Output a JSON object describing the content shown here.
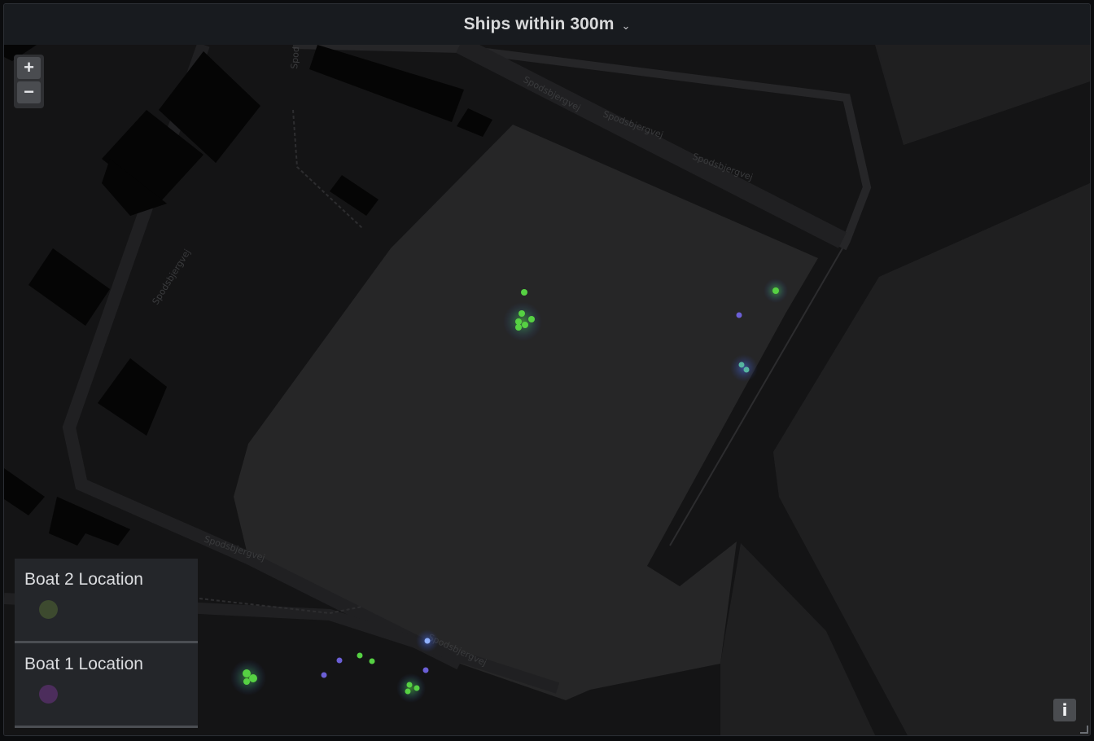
{
  "panel": {
    "title": "Ships within 300m",
    "chevron_icon": "chevron-down-icon"
  },
  "map": {
    "zoom_in_label": "+",
    "zoom_out_label": "−",
    "info_label": "i",
    "street_name": "Spodsbjergvej",
    "street_name_partial": "Spod",
    "colors": {
      "water": "#1f1f20",
      "land": "#141415",
      "buildings": "#050505",
      "basin": "#262627",
      "boat2": "#56d143",
      "boat1": "#6b5fd6"
    }
  },
  "legend": [
    {
      "label": "Boat 2 Location",
      "color": "#3d4a2f"
    },
    {
      "label": "Boat 1 Location",
      "color": "#4c2d5c"
    }
  ]
}
